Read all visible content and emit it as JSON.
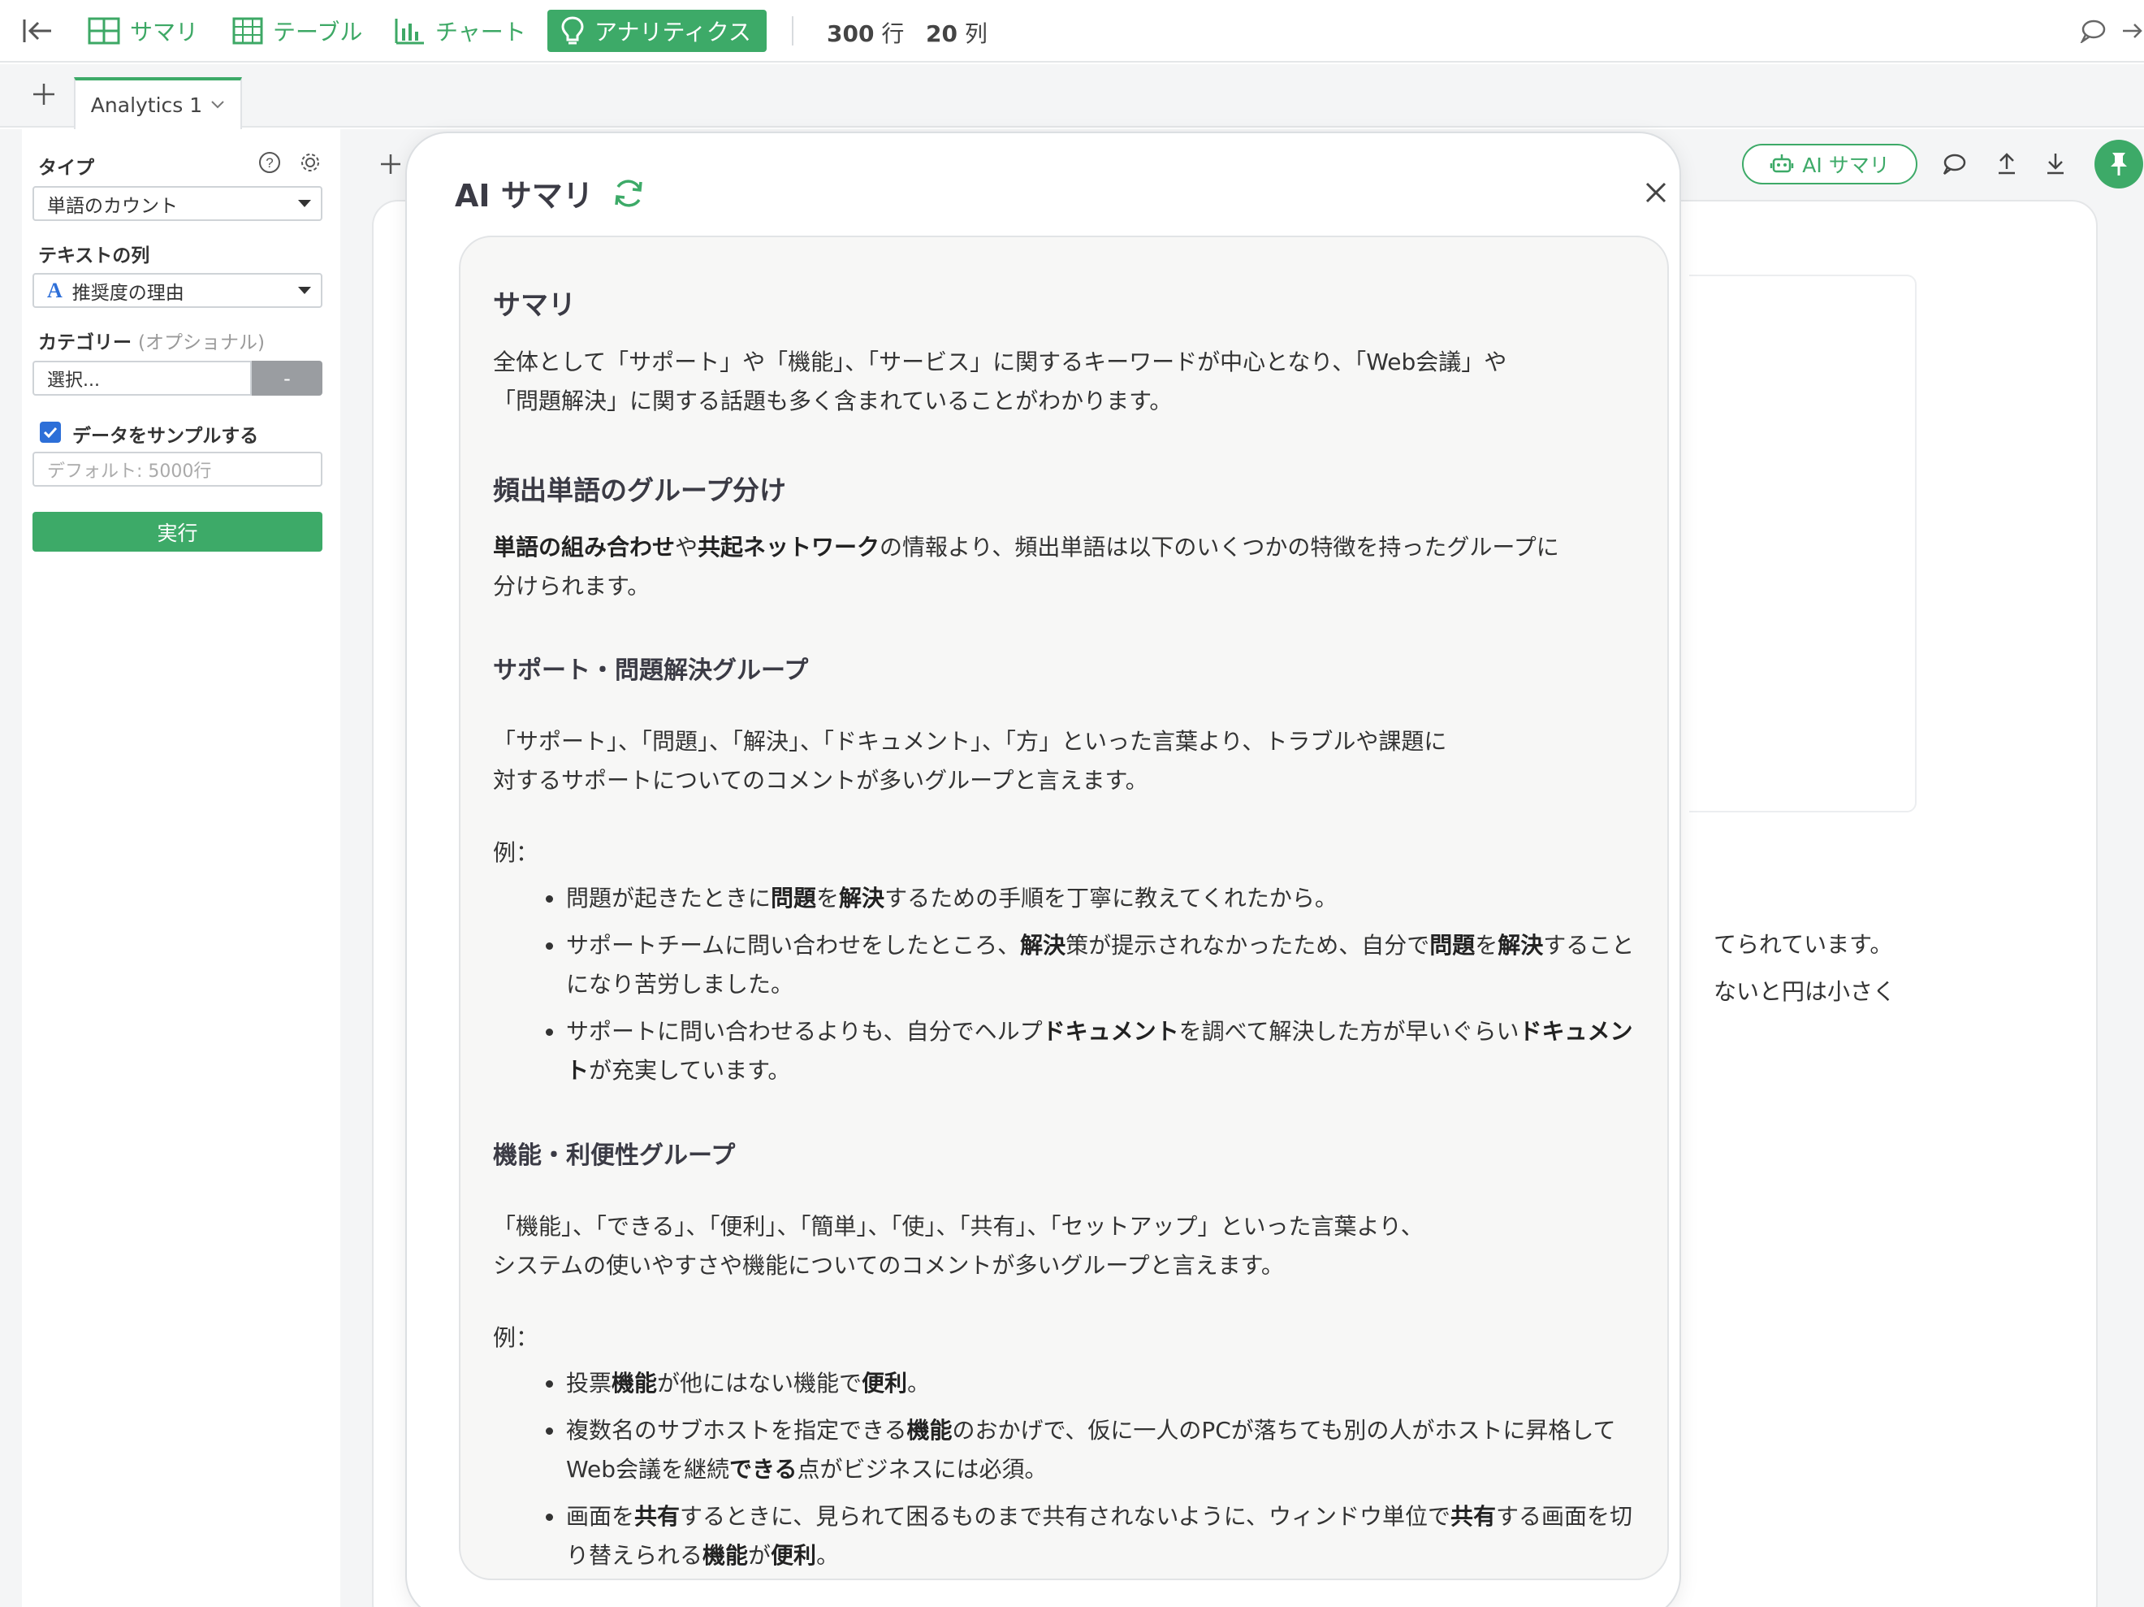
{
  "toolbar": {
    "tabs": [
      {
        "label": "サマリ",
        "icon": "grid-summary-icon",
        "active": false
      },
      {
        "label": "テーブル",
        "icon": "table-icon",
        "active": false
      },
      {
        "label": "チャート",
        "icon": "bar-chart-icon",
        "active": false
      },
      {
        "label": "アナリティクス",
        "icon": "lightbulb-icon",
        "active": true
      }
    ],
    "rows_value": "300",
    "rows_unit": "行",
    "cols_value": "20",
    "cols_unit": "列"
  },
  "tabbar": {
    "tab_label": "Analytics 1"
  },
  "left_panel": {
    "type_label": "タイプ",
    "type_value": "単語のカウント",
    "text_col_label": "テキストの列",
    "text_col_value": "推奨度の理由",
    "text_col_type_glyph": "A",
    "category_label": "カテゴリー",
    "category_optional": "(オプショナル)",
    "category_placeholder": "選択...",
    "category_clear": "-",
    "sample_checked": true,
    "sample_label": "データをサンプルする",
    "sample_placeholder": "デフォルト: 5000行",
    "run_label": "実行"
  },
  "main": {
    "ai_summary_button": "AI サマリ",
    "bg_text_1": "てられています。",
    "bg_text_2": "ないと円は小さく"
  },
  "modal": {
    "title": "AI サマリ",
    "summary_heading": "サマリ",
    "summary_line1": "全体として「サポート」や「機能」、「サービス」に関するキーワードが中心となり、「Web会議」や",
    "summary_line2": "「問題解決」に関する話題も多く含まれていることがわかります。",
    "groups_heading": "頻出単語のグループ分け",
    "groups_b1": "単語の組み合わせ",
    "groups_t1": "や",
    "groups_b2": "共起ネットワーク",
    "groups_t2": "の情報より、頻出単語は以下のいくつかの特徴を持ったグループに",
    "groups_line2": "分けられます。",
    "g1_heading": "サポート・問題解決グループ",
    "g1_line1": "「サポート」、「問題」、「解決」、「ドキュメント」、「方」といった言葉より、トラブルや課題に",
    "g1_line2": "対するサポートについてのコメントが多いグループと言えます。",
    "g1_example": "例：",
    "g1_ex1": {
      "t1": "問題が起きたときに",
      "b1": "問題",
      "t2": "を",
      "b2": "解決",
      "t3": "するための手順を丁寧に教えてくれたから。"
    },
    "g1_ex2": {
      "t1": "サポートチームに問い合わせをしたところ、",
      "b1": "解決",
      "t2": "策が提示されなかったため、自分で",
      "b2": "問題",
      "t3": "を",
      "b3": "解決",
      "t4": "することになり苦労しました。"
    },
    "g1_ex3": {
      "t1": "サポートに問い合わせるよりも、自分でヘルプ",
      "b1": "ドキュメント",
      "t2": "を調べて解決した方が早いぐらい",
      "b2": "ドキュメント",
      "t3": "が充実しています。"
    },
    "g2_heading": "機能・利便性グループ",
    "g2_line1": "「機能」、「できる」、「便利」、「簡単」、「使」、「共有」、「セットアップ」といった言葉より、",
    "g2_line2": "システムの使いやすさや機能についてのコメントが多いグループと言えます。",
    "g2_example": "例：",
    "g2_ex1": {
      "t1": "投票",
      "b1": "機能",
      "t2": "が他にはない機能で",
      "b2": "便利",
      "t3": "。"
    },
    "g2_ex2": {
      "t1": "複数名のサブホストを指定できる",
      "b1": "機能",
      "t2": "のおかげで、仮に一人のPCが落ちても別の人がホストに昇格してWeb会議を継続",
      "b2": "できる",
      "t3": "点がビジネスには必須。"
    },
    "g2_ex3": {
      "t1": "画面を",
      "b1": "共有",
      "t2": "するときに、見られて困るものまで共有されないように、ウィンドウ単位で",
      "b2": "共有",
      "t3": "する画面を切り替えられる",
      "b3": "機能",
      "t4": "が",
      "b4": "便利",
      "t5": "。"
    }
  },
  "colors": {
    "accent": "#3daa68",
    "text": "#333333",
    "heading": "#3b3b45",
    "panel_bg": "#f4f5f6"
  }
}
